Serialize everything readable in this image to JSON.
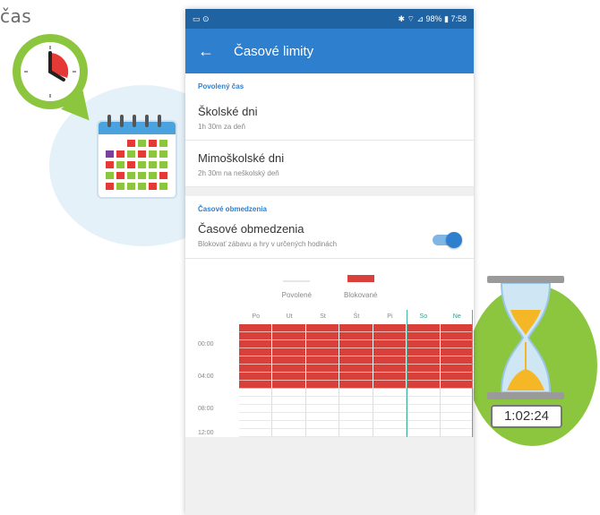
{
  "page_heading": "čas",
  "illustration_left": {
    "clock_icon": "clock-icon",
    "calendar_icon": "calendar-icon"
  },
  "illustration_right": {
    "hourglass_icon": "hourglass-icon",
    "timer_value": "1:02:24"
  },
  "phone": {
    "statusbar": {
      "left_icons": "▭ ⊙",
      "right_text": "✱ ⌔ ⊿ 98% ▮ 7:58"
    },
    "appbar": {
      "back_icon": "arrow-left-icon",
      "title": "Časové limity"
    },
    "allowed_time": {
      "section_label": "Povolený čas",
      "rows": [
        {
          "title": "Školské dni",
          "subtitle": "1h 30m za deň"
        },
        {
          "title": "Mimoškolské dni",
          "subtitle": "2h 30m na neškolský deň"
        }
      ]
    },
    "restrictions": {
      "section_label": "Časové obmedzenia",
      "toggle_title": "Časové obmedzenia",
      "toggle_subtitle": "Blokovať zábavu a hry v určených hodinách",
      "toggle_on": true
    },
    "legend": {
      "allowed_label": "Povolené",
      "blocked_label": "Blokované",
      "allowed_color": "#e6e6e6",
      "blocked_color": "#d9403a"
    },
    "schedule": {
      "days": [
        "Po",
        "Ut",
        "St",
        "Št",
        "Pi",
        "So",
        "Ne"
      ],
      "weekend_days": [
        "So",
        "Ne"
      ],
      "time_labels": [
        "00:00",
        "04:00",
        "08:00",
        "12:00"
      ],
      "blocked_rows": 8,
      "total_rows": 14
    }
  }
}
